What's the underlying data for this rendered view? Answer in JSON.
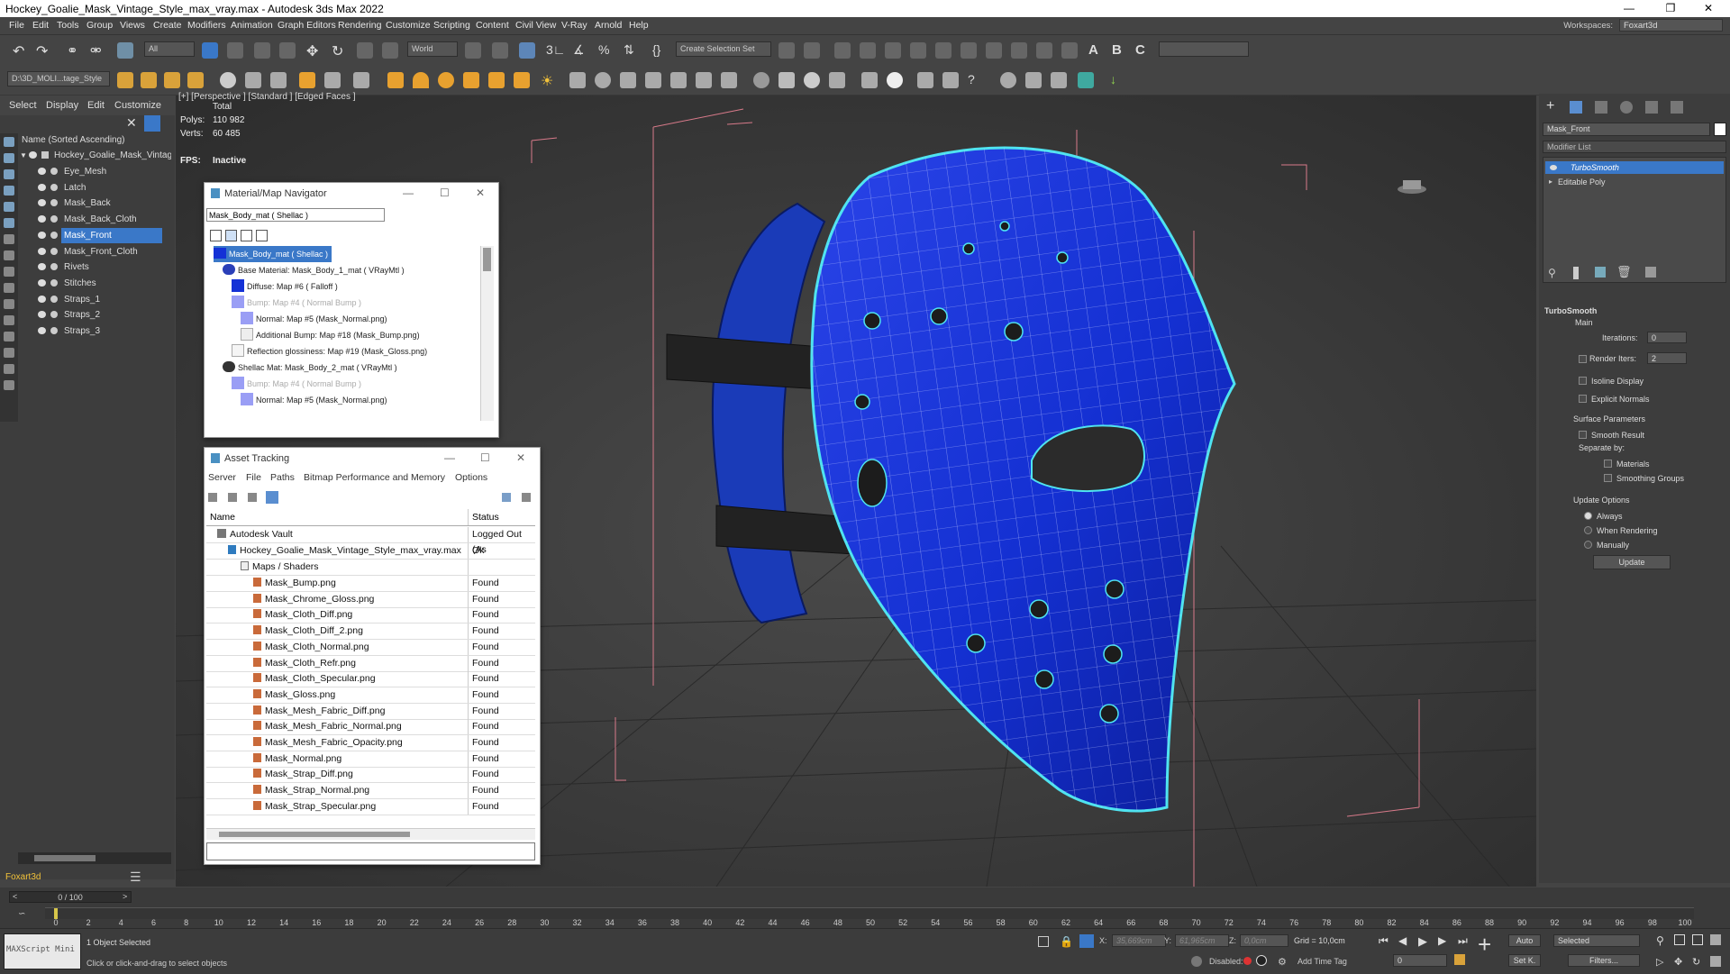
{
  "window": {
    "title": "Hockey_Goalie_Mask_Vintage_Style_max_vray.max - Autodesk 3ds Max 2022"
  },
  "menu": [
    "File",
    "Edit",
    "Tools",
    "Group",
    "Views",
    "Create",
    "Modifiers",
    "Animation",
    "Graph Editors",
    "Rendering",
    "Customize",
    "Scripting",
    "Content",
    "Civil View",
    "V-Ray",
    "Arnold",
    "Help"
  ],
  "workspace": {
    "label": "Workspaces:",
    "value": "Foxart3d"
  },
  "toolbar": {
    "layer": "All",
    "coord": "World",
    "selection_set": "Create Selection Set",
    "path": "D:\\3D_MOLI...tage_Style"
  },
  "scene_explorer": {
    "tabs": [
      "Select",
      "Display",
      "Edit",
      "Customize"
    ],
    "sort_header": "Name (Sorted Ascending)",
    "root": "Hockey_Goalie_Mask_Vintage_",
    "objects": [
      "Eye_Mesh",
      "Latch",
      "Mask_Back",
      "Mask_Back_Cloth",
      "Mask_Front",
      "Mask_Front_Cloth",
      "Rivets",
      "Stitches",
      "Straps_1",
      "Straps_2",
      "Straps_3"
    ],
    "selected_index": 4,
    "layer_name": "Foxart3d"
  },
  "viewport": {
    "label": "[+] [Perspective ] [Standard ] [Edged Faces ]",
    "stats_title": "Total",
    "polys_label": "Polys:",
    "polys": "110 982",
    "verts_label": "Verts:",
    "verts": "60 485",
    "fps_label": "FPS:",
    "fps": "Inactive"
  },
  "material_navigator": {
    "title": "Material/Map Navigator",
    "field": "Mask_Body_mat  ( Shellac )",
    "rows": [
      "Mask_Body_mat  ( Shellac )",
      "Base Material: Mask_Body_1_mat  ( VRayMtl )",
      "Diffuse: Map #6  ( Falloff )",
      "Bump: Map #4  ( Normal Bump )",
      "Normal: Map #5 (Mask_Normal.png)",
      "Additional Bump: Map #18 (Mask_Bump.png)",
      "Reflection glossiness: Map #19 (Mask_Gloss.png)",
      "Shellac Mat: Mask_Body_2_mat  ( VRayMtl )",
      "Bump: Map #4  ( Normal Bump )",
      "Normal: Map #5 (Mask_Normal.png)"
    ]
  },
  "asset_tracking": {
    "title": "Asset Tracking",
    "menu": [
      "Server",
      "File",
      "Paths",
      "Bitmap Performance and Memory",
      "Options"
    ],
    "col_name": "Name",
    "col_status": "Status",
    "vault": {
      "name": "Autodesk Vault",
      "status": "Logged Out (As"
    },
    "file": {
      "name": "Hockey_Goalie_Mask_Vintage_Style_max_vray.max",
      "status": "Ok"
    },
    "folder": "Maps / Shaders",
    "maps": [
      {
        "name": "Mask_Bump.png",
        "status": "Found"
      },
      {
        "name": "Mask_Chrome_Gloss.png",
        "status": "Found"
      },
      {
        "name": "Mask_Cloth_Diff.png",
        "status": "Found"
      },
      {
        "name": "Mask_Cloth_Diff_2.png",
        "status": "Found"
      },
      {
        "name": "Mask_Cloth_Normal.png",
        "status": "Found"
      },
      {
        "name": "Mask_Cloth_Refr.png",
        "status": "Found"
      },
      {
        "name": "Mask_Cloth_Specular.png",
        "status": "Found"
      },
      {
        "name": "Mask_Gloss.png",
        "status": "Found"
      },
      {
        "name": "Mask_Mesh_Fabric_Diff.png",
        "status": "Found"
      },
      {
        "name": "Mask_Mesh_Fabric_Normal.png",
        "status": "Found"
      },
      {
        "name": "Mask_Mesh_Fabric_Opacity.png",
        "status": "Found"
      },
      {
        "name": "Mask_Normal.png",
        "status": "Found"
      },
      {
        "name": "Mask_Strap_Diff.png",
        "status": "Found"
      },
      {
        "name": "Mask_Strap_Normal.png",
        "status": "Found"
      },
      {
        "name": "Mask_Strap_Specular.png",
        "status": "Found"
      }
    ]
  },
  "command_panel": {
    "object_name": "Mask_Front",
    "modifier_list": "Modifier List",
    "stack": [
      "TurboSmooth",
      "Editable Poly"
    ],
    "rollout": "TurboSmooth",
    "main": "Main",
    "iterations_label": "Iterations:",
    "iterations": "0",
    "render_iters_label": "Render Iters:",
    "render_iters": "2",
    "isoline": "Isoline Display",
    "explicit_normals": "Explicit Normals",
    "surface_params": "Surface Parameters",
    "smooth_result": "Smooth Result",
    "separate_by": "Separate by:",
    "materials": "Materials",
    "smoothing_groups": "Smoothing Groups",
    "update_options": "Update Options",
    "always": "Always",
    "when_rendering": "When Rendering",
    "manually": "Manually",
    "update_btn": "Update"
  },
  "timeline": {
    "frame": "0 / 100",
    "ticks": [
      "0",
      "2",
      "4",
      "6",
      "8",
      "10",
      "12",
      "14",
      "16",
      "18",
      "20",
      "22",
      "24",
      "26",
      "28",
      "30",
      "32",
      "34",
      "36",
      "38",
      "40",
      "42",
      "44",
      "46",
      "48",
      "50",
      "52",
      "54",
      "56",
      "58",
      "60",
      "62",
      "64",
      "66",
      "68",
      "70",
      "72",
      "74",
      "76",
      "78",
      "80",
      "82",
      "84",
      "86",
      "88",
      "90",
      "92",
      "94",
      "96",
      "98",
      "100"
    ]
  },
  "status_bar": {
    "maxscript": "MAXScript Mini",
    "selected": "1 Object Selected",
    "prompt": "Click or click-and-drag to select objects",
    "x_label": "X:",
    "x": "35,669cm",
    "y_label": "Y:",
    "y": "61,965cm",
    "z_label": "Z:",
    "z": "0,0cm",
    "grid": "Grid = 10,0cm",
    "disabled": "Disabled:",
    "add_time_tag": "Add Time Tag",
    "auto": "Auto",
    "set_key": "Set K.",
    "selected_dd": "Selected",
    "filters": "Filters...",
    "frame_field": "0"
  },
  "colors": {
    "mask_blue": "#1431d6",
    "selection": "#3a78c8",
    "wire_highlight": "#4fe3f0"
  }
}
